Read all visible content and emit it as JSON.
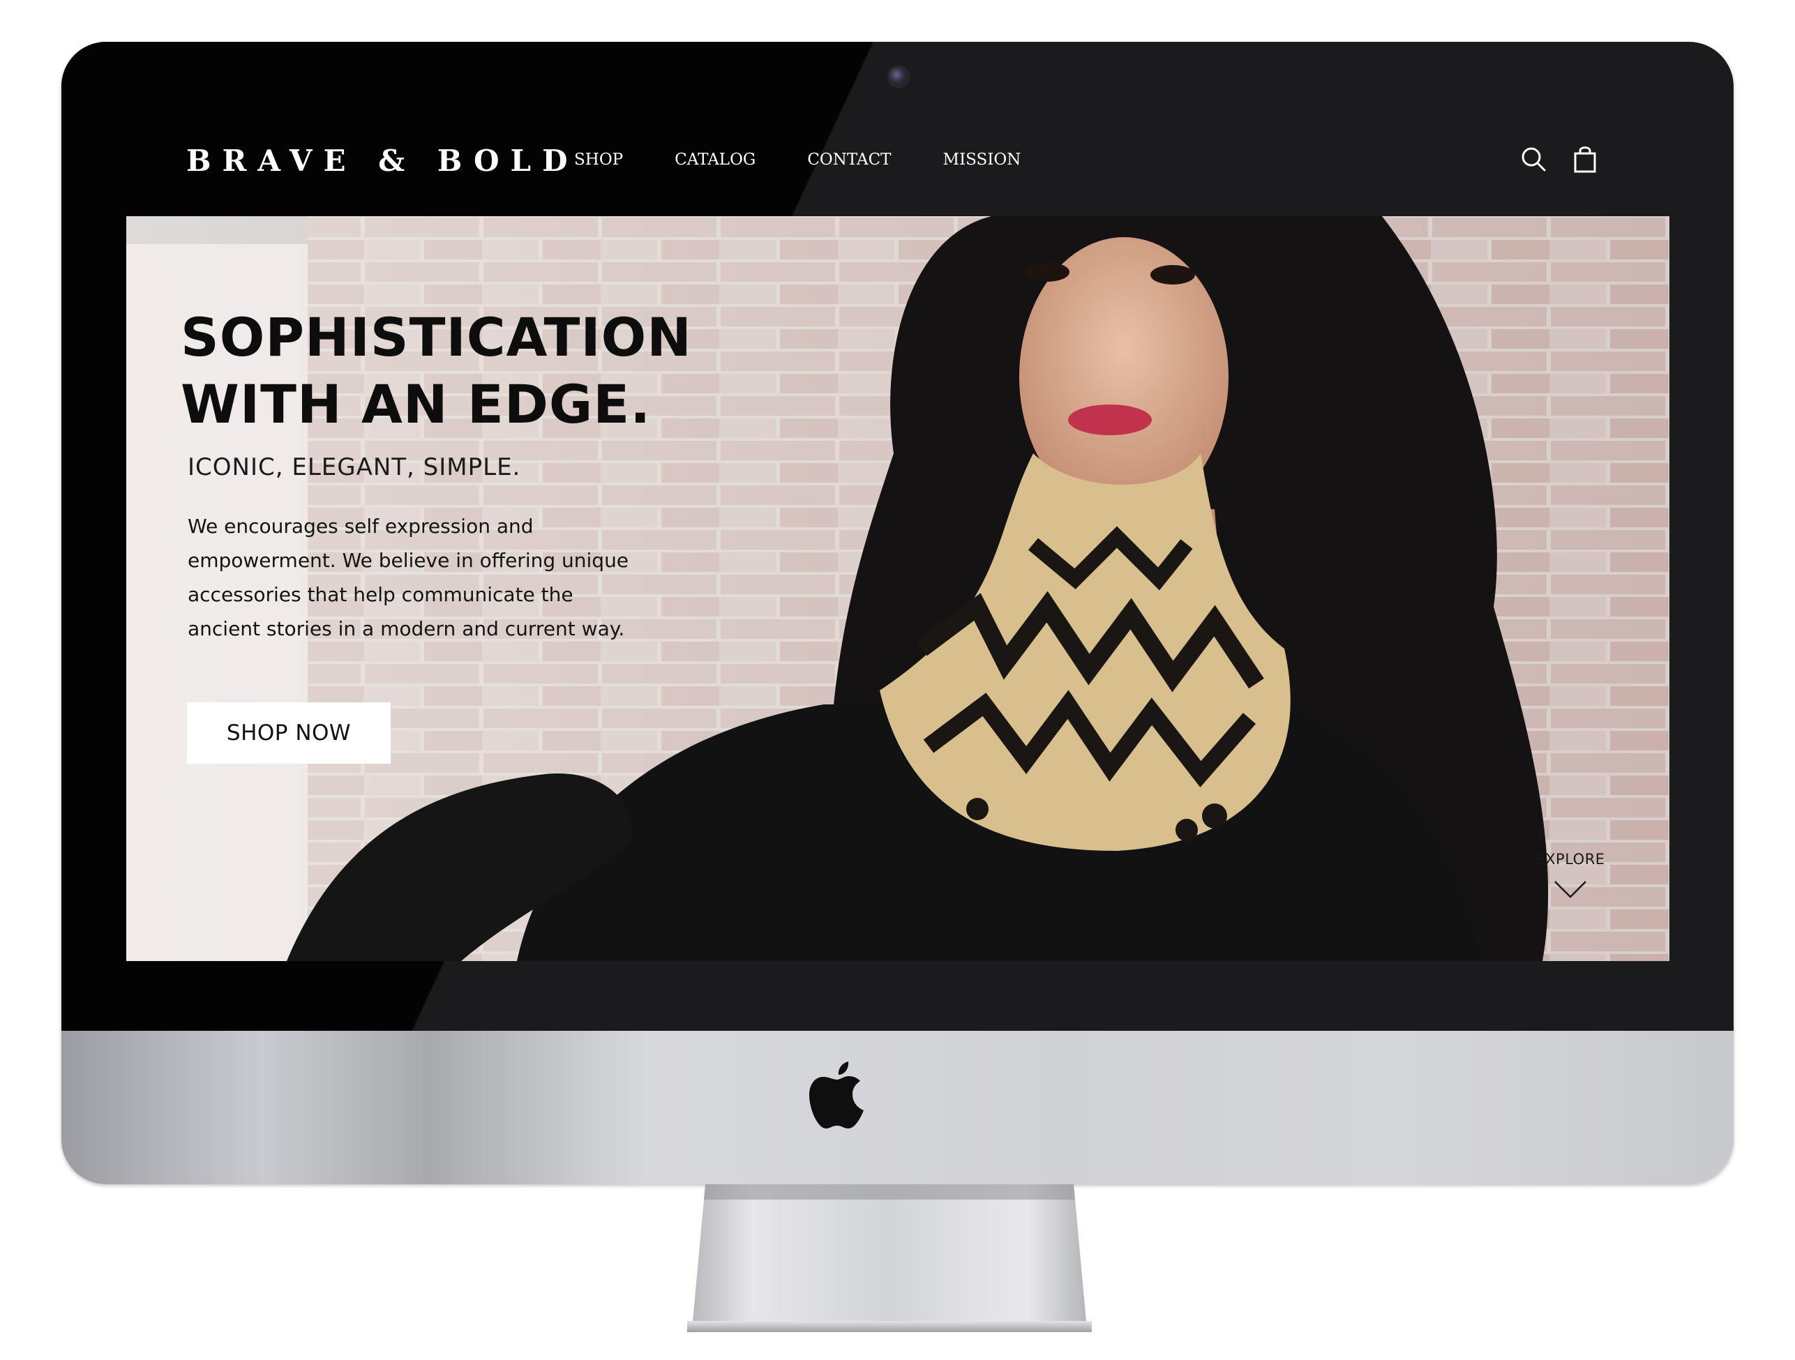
{
  "site": {
    "logo": "BRAVE & BOLD",
    "nav": [
      {
        "label": "SHOP"
      },
      {
        "label": "CATALOG"
      },
      {
        "label": "CONTACT"
      },
      {
        "label": "MISSION"
      }
    ],
    "icons": {
      "search": "search-icon",
      "cart": "shopping-bag-icon"
    }
  },
  "hero": {
    "title_line1": "SOPHISTICATION",
    "title_line2": "WITH AN EDGE.",
    "subtitle": "ICONIC, ELEGANT, SIMPLE.",
    "description": "We encourages self expression and empowerment. We believe in offering unique accessories that help communicate the ancient stories in a modern and current way.",
    "cta_label": "SHOP NOW",
    "explore_label": "EXPLORE"
  },
  "colors": {
    "bezel": "#1b1a1c",
    "header_text": "#ffffff",
    "hero_text": "#0d0d0d",
    "button_bg": "#ffffff",
    "chin": "#d0d1d5"
  }
}
